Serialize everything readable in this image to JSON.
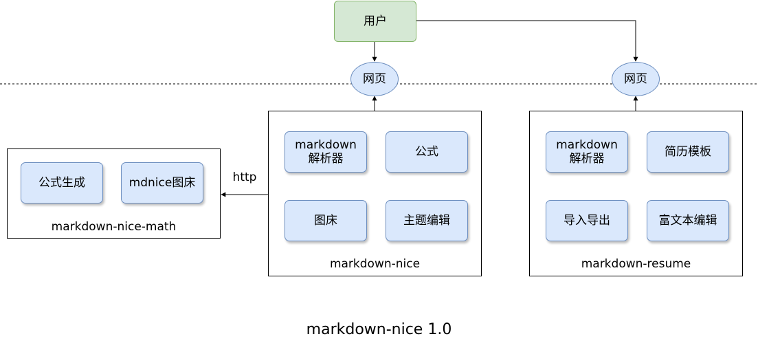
{
  "user": "用户",
  "web_left": "网页",
  "web_right": "网页",
  "http": "http",
  "containers": {
    "math": {
      "title": "markdown-nice-math",
      "items": [
        "公式生成",
        "mdnice图床"
      ]
    },
    "nice": {
      "title": "markdown-nice",
      "items": [
        "markdown\n解析器",
        "公式",
        "图床",
        "主题编辑"
      ]
    },
    "resume": {
      "title": "markdown-resume",
      "items": [
        "markdown\n解析器",
        "简历模板",
        "导入导出",
        "富文本编辑"
      ]
    }
  },
  "caption": "markdown-nice 1.0",
  "colors": {
    "user_fill": "#d5e8d4",
    "user_border": "#82b366",
    "module_fill": "#dae8fc",
    "module_border": "#6c8ebf"
  }
}
